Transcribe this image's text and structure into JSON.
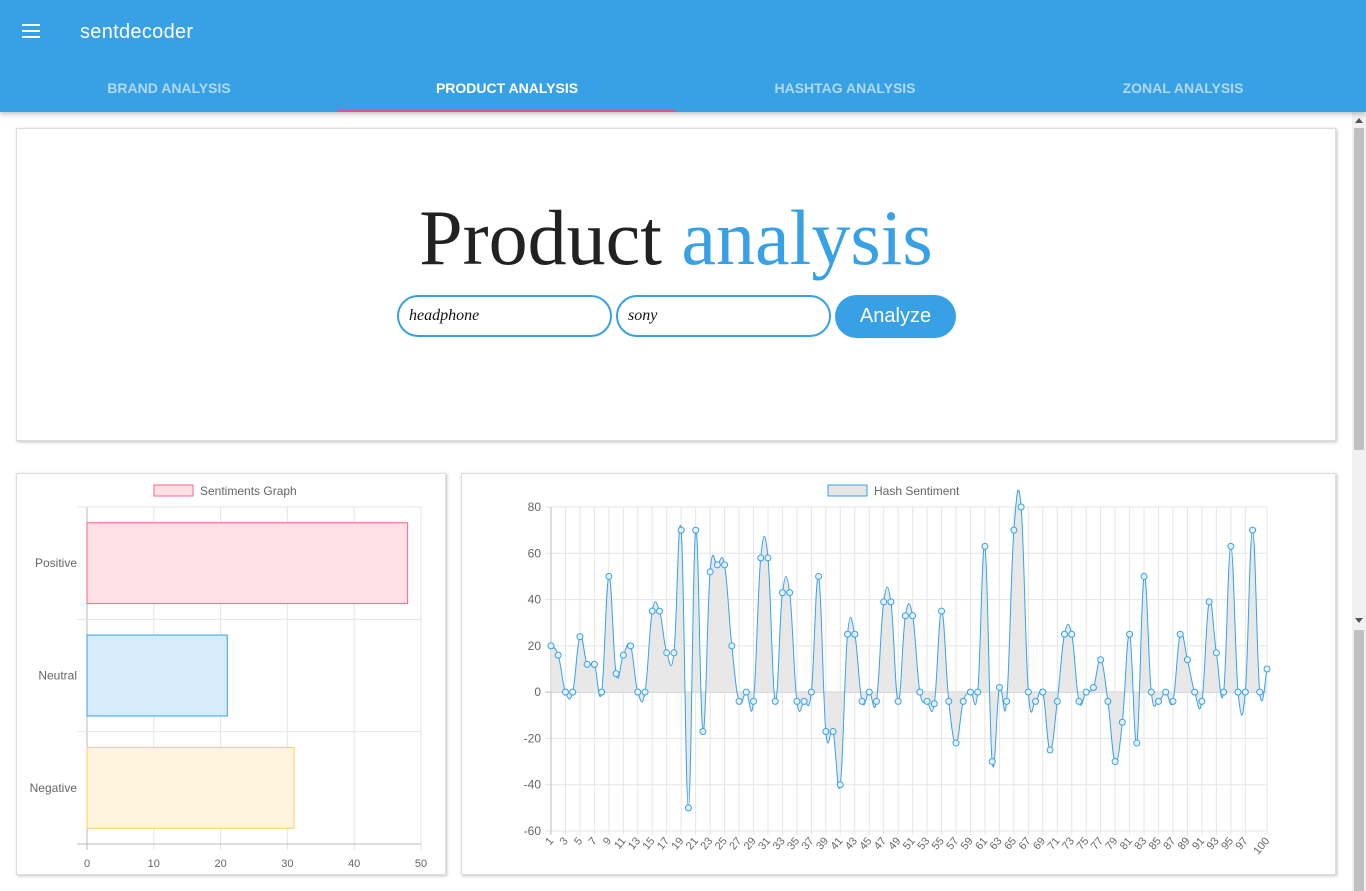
{
  "app": {
    "title": "sentdecoder"
  },
  "tabs": [
    {
      "label": "BRAND ANALYSIS"
    },
    {
      "label": "PRODUCT ANALYSIS"
    },
    {
      "label": "HASHTAG ANALYSIS"
    },
    {
      "label": "ZONAL ANALYSIS"
    }
  ],
  "hero": {
    "title_plain": "Product",
    "title_accent": "analysis",
    "product_value": "headphone",
    "brand_value": "sony",
    "analyze_label": "Analyze"
  },
  "colors": {
    "primary": "#38a1e6",
    "tab_indicator": "#e84f84"
  },
  "chart_data": [
    {
      "type": "bar",
      "orientation": "horizontal",
      "legend": "Sentiments Graph",
      "categories": [
        "Positive",
        "Neutral",
        "Negative"
      ],
      "values": [
        48,
        21,
        31
      ],
      "xlim": [
        0,
        50
      ],
      "xticks": [
        0,
        10,
        20,
        30,
        40,
        50
      ],
      "colors": [
        {
          "fill": "#ffe0e7",
          "stroke": "#ff6384"
        },
        {
          "fill": "#d7ecfb",
          "stroke": "#36a2eb"
        },
        {
          "fill": "#fff4dd",
          "stroke": "#ffce56"
        }
      ],
      "grid": true,
      "legend_position": "top"
    },
    {
      "type": "area",
      "legend": "Hash Sentiment",
      "x": [
        1,
        2,
        3,
        4,
        5,
        6,
        7,
        8,
        9,
        10,
        11,
        12,
        13,
        14,
        15,
        16,
        17,
        18,
        19,
        20,
        21,
        22,
        23,
        24,
        25,
        26,
        27,
        28,
        29,
        30,
        31,
        32,
        33,
        34,
        35,
        36,
        37,
        38,
        39,
        40,
        41,
        42,
        43,
        44,
        45,
        46,
        47,
        48,
        49,
        50,
        51,
        52,
        53,
        54,
        55,
        56,
        57,
        58,
        59,
        60,
        61,
        62,
        63,
        64,
        65,
        66,
        67,
        68,
        69,
        70,
        71,
        72,
        73,
        74,
        75,
        76,
        77,
        78,
        79,
        80,
        81,
        82,
        83,
        84,
        85,
        86,
        87,
        88,
        89,
        90,
        91,
        92,
        93,
        94,
        95,
        96,
        97,
        98,
        99,
        100
      ],
      "values": [
        20,
        16,
        0,
        0,
        24,
        12,
        12,
        0,
        50,
        8,
        16,
        20,
        0,
        0,
        35,
        35,
        17,
        17,
        70,
        -50,
        70,
        -17,
        52,
        55,
        55,
        20,
        -4,
        0,
        -4,
        58,
        58,
        -4,
        43,
        43,
        -4,
        -4,
        0,
        50,
        -17,
        -17,
        -40,
        25,
        25,
        -4,
        0,
        -4,
        39,
        39,
        -4,
        33,
        33,
        0,
        -4,
        -5,
        35,
        -4,
        -22,
        -4,
        0,
        0,
        63,
        -30,
        2,
        -4,
        70,
        80,
        0,
        -4,
        0,
        -25,
        -4,
        25,
        25,
        -4,
        0,
        2,
        14,
        -4,
        -30,
        -13,
        25,
        -22,
        50,
        0,
        -4,
        0,
        -4,
        25,
        14,
        0,
        -4,
        39,
        17,
        0,
        63,
        0,
        0,
        70,
        0,
        10
      ],
      "ylim": [
        -60,
        80
      ],
      "yticks": [
        -60,
        -40,
        -20,
        0,
        20,
        40,
        60,
        80
      ],
      "xticks_shown": [
        1,
        3,
        5,
        7,
        9,
        11,
        13,
        15,
        17,
        19,
        21,
        23,
        25,
        27,
        29,
        31,
        33,
        35,
        37,
        39,
        41,
        43,
        45,
        47,
        49,
        51,
        53,
        55,
        57,
        59,
        61,
        63,
        65,
        67,
        69,
        71,
        73,
        75,
        77,
        79,
        81,
        83,
        85,
        87,
        89,
        91,
        93,
        95,
        97,
        100
      ],
      "line_color": "#36a2eb",
      "fill_color": "#e6e6e6",
      "grid": true,
      "legend_position": "top"
    }
  ]
}
